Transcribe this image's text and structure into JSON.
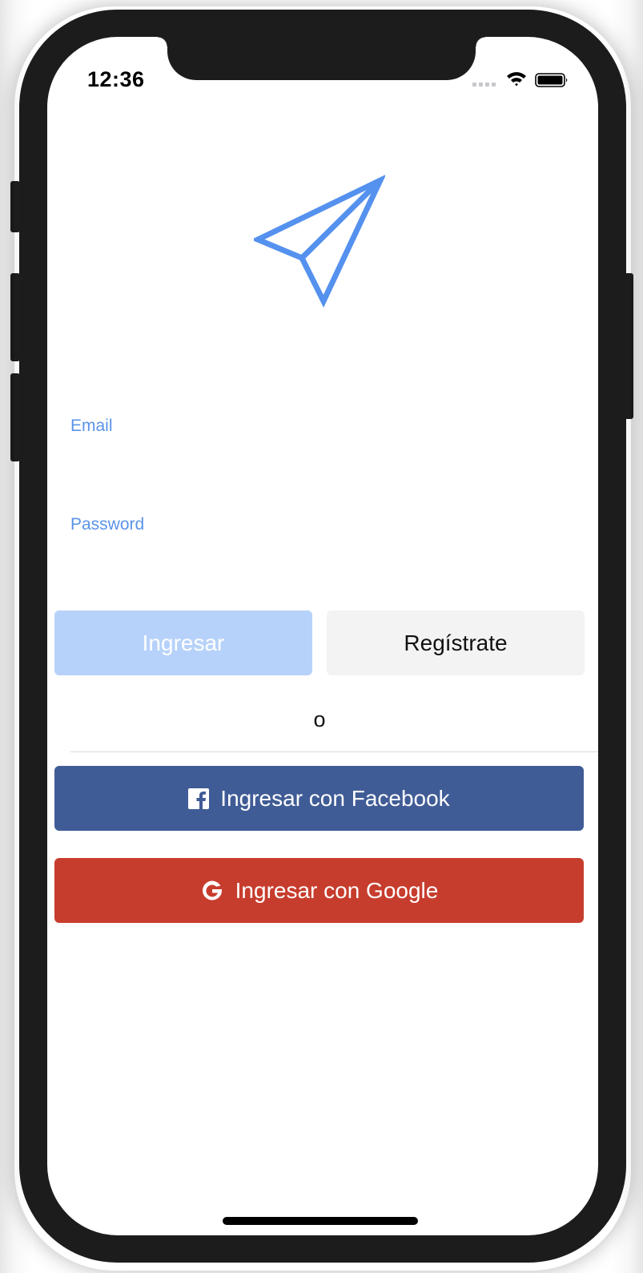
{
  "status_bar": {
    "time": "12:36"
  },
  "icons": {
    "logo": "paper-plane-icon",
    "wifi": "wifi-icon",
    "battery": "battery-icon",
    "facebook": "facebook-icon",
    "google": "google-icon"
  },
  "form": {
    "email_label": "Email",
    "email_value": "",
    "password_label": "Password",
    "password_value": ""
  },
  "buttons": {
    "login": "Ingresar",
    "register": "Regístrate",
    "facebook": "Ingresar con Facebook",
    "google": "Ingresar con Google"
  },
  "separator_text": "o",
  "colors": {
    "accent": "#5b93e8",
    "login_disabled": "#b7d2fa",
    "register_bg": "#f3f3f3",
    "facebook": "#405c96",
    "google": "#c73d2d"
  }
}
